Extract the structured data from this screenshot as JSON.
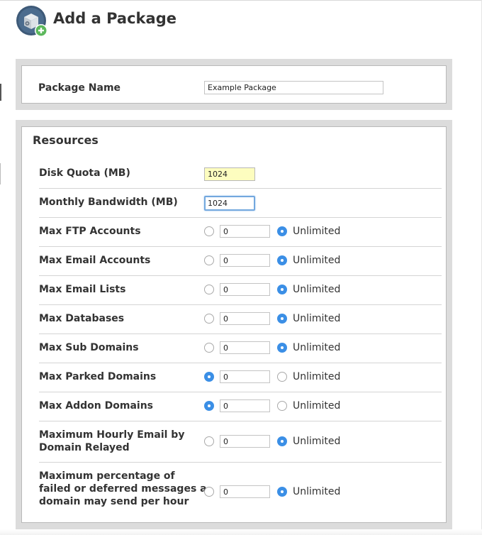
{
  "header": {
    "title": "Add a Package",
    "icon": "package-add-icon",
    "icon_colors": {
      "circle": "#3e5a78",
      "plus_badge": "#5cb85c"
    }
  },
  "package_name": {
    "label": "Package Name",
    "value": "Example Package"
  },
  "resources": {
    "title": "Resources",
    "disk_quota": {
      "label": "Disk Quota (MB)",
      "value": "1024"
    },
    "monthly_bandwidth": {
      "label": "Monthly Bandwidth (MB)",
      "value": "1024"
    },
    "unlimited_label": "Unlimited",
    "rows": [
      {
        "key": "max-ftp-accounts",
        "label": "Max FTP Accounts",
        "value": "0",
        "selected": "unlimited"
      },
      {
        "key": "max-email-accounts",
        "label": "Max Email Accounts",
        "value": "0",
        "selected": "unlimited"
      },
      {
        "key": "max-email-lists",
        "label": "Max Email Lists",
        "value": "0",
        "selected": "unlimited"
      },
      {
        "key": "max-databases",
        "label": "Max Databases",
        "value": "0",
        "selected": "unlimited"
      },
      {
        "key": "max-sub-domains",
        "label": "Max Sub Domains",
        "value": "0",
        "selected": "unlimited"
      },
      {
        "key": "max-parked-domains",
        "label": "Max Parked Domains",
        "value": "0",
        "selected": "value"
      },
      {
        "key": "max-addon-domains",
        "label": "Max Addon Domains",
        "value": "0",
        "selected": "value"
      },
      {
        "key": "max-hourly-email-relayed",
        "label_lines": [
          "Maximum Hourly Email by",
          "Domain Relayed"
        ],
        "value": "0",
        "selected": "unlimited"
      },
      {
        "key": "max-failed-deferred-percentage",
        "label_lines": [
          "Maximum percentage of",
          "failed or deferred messages a",
          "domain may send per hour"
        ],
        "value": "0",
        "selected": "unlimited"
      }
    ]
  },
  "colors": {
    "radio_checked": "#3b8fe6",
    "panel_frame": "#dcdcdc",
    "highlight_input": "#fdfdbf",
    "focus_ring": "#73a8de"
  }
}
